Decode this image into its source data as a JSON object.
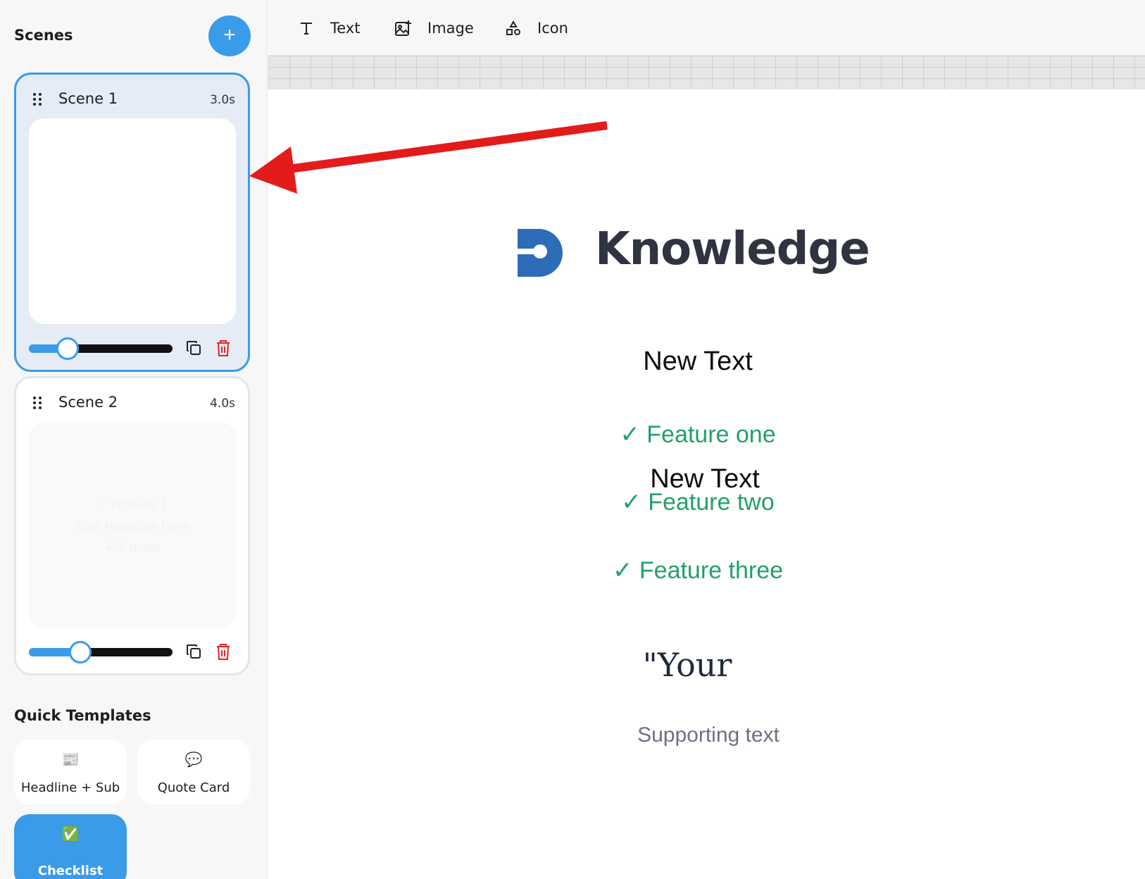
{
  "sidebar": {
    "title": "Scenes",
    "add_label": "+",
    "scenes": [
      {
        "name": "Scene 1",
        "duration": "3.0s",
        "slider_fraction": 0.27,
        "thumb_lines": []
      },
      {
        "name": "Scene 2",
        "duration": "4.0s",
        "slider_fraction": 0.36,
        "thumb_lines": [
          "✓ Feature 1",
          "Your Headline Here",
          "+ 2 more"
        ]
      }
    ],
    "quick_templates": {
      "title": "Quick Templates",
      "items": [
        {
          "label": "Headline + Sub",
          "icon": "newspaper-icon",
          "glyph": "📰"
        },
        {
          "label": "Quote Card",
          "icon": "speech-bubble-icon",
          "glyph": "💬"
        },
        {
          "label": "Checklist",
          "icon": "check-box-icon",
          "glyph": "✅"
        }
      ]
    }
  },
  "toolbar": {
    "text_label": "Text",
    "image_label": "Image",
    "icon_label": "Icon"
  },
  "canvas": {
    "logo_text": "Knowledge",
    "new_text_1": "New Text",
    "new_text_2": "New Text",
    "features": [
      "✓ Feature one",
      "✓ Feature two",
      "✓ Feature three"
    ],
    "quote": "\"Your",
    "supporting": "Supporting text"
  },
  "colors": {
    "accent": "#3a9be9",
    "feature_green": "#23a06a",
    "delete_red": "#e02424",
    "annotation_arrow": "#e31b1b"
  }
}
